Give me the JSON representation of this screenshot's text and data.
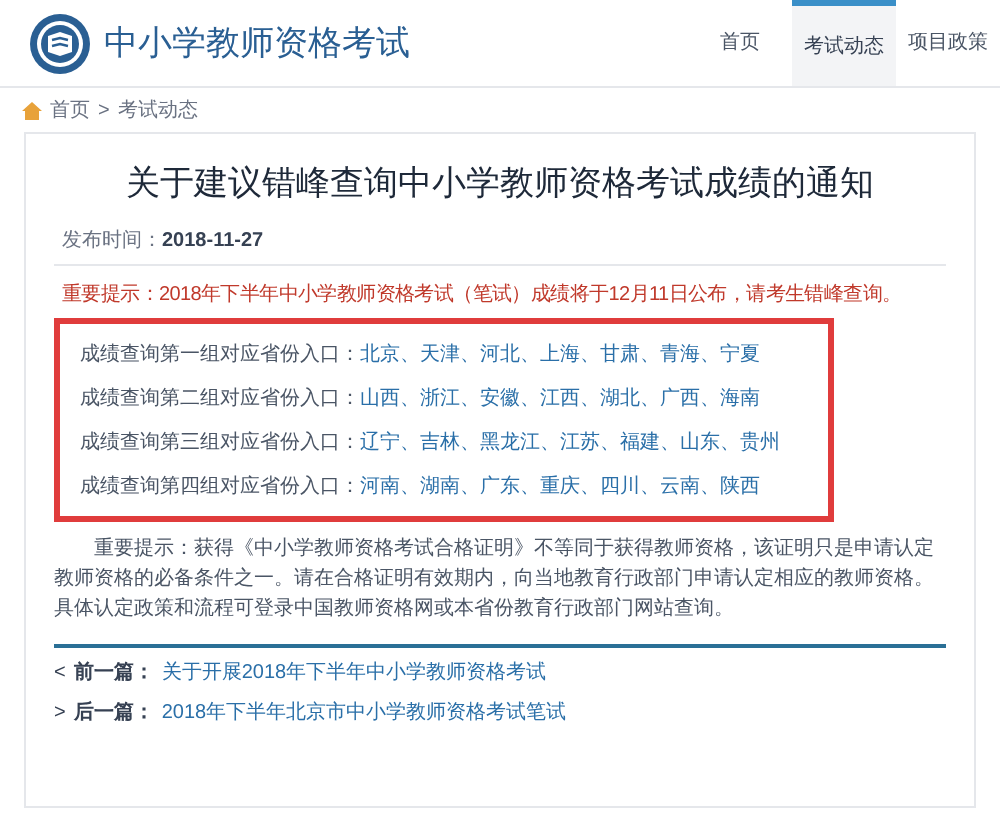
{
  "header": {
    "site_title": "中小学教师资格考试",
    "nav": [
      {
        "label": "首页",
        "selected": false
      },
      {
        "label": "考试动态",
        "selected": true
      },
      {
        "label": "项目政策",
        "selected": false
      }
    ]
  },
  "breadcrumb": [
    "首页",
    "考试动态"
  ],
  "breadcrumb_separator": ">",
  "article": {
    "title": "关于建议错峰查询中小学教师资格考试成绩的通知",
    "date_label": "发布时间：",
    "date": "2018-11-27",
    "notice": "重要提示：2018年下半年中小学教师资格考试（笔试）成绩将于12月11日公布，请考生错峰查询。",
    "groups": [
      {
        "label": "成绩查询第一组对应省份入口：",
        "provinces": "北京、天津、河北、上海、甘肃、青海、宁夏"
      },
      {
        "label": "成绩查询第二组对应省份入口：",
        "provinces": "山西、浙江、安徽、江西、湖北、广西、海南"
      },
      {
        "label": "成绩查询第三组对应省份入口：",
        "provinces": "辽宁、吉林、黑龙江、江苏、福建、山东、贵州"
      },
      {
        "label": "成绩查询第四组对应省份入口：",
        "provinces": "河南、湖南、广东、重庆、四川、云南、陕西"
      }
    ],
    "paragraph": "重要提示：获得《中小学教师资格考试合格证明》不等同于获得教师资格，该证明只是申请认定教师资格的必备条件之一。请在合格证明有效期内，向当地教育行政部门申请认定相应的教师资格。具体认定政策和流程可登录中国教师资格网或本省份教育行政部门网站查询。",
    "prev": {
      "marker": "<",
      "label": "前一篇：",
      "link": "关于开展2018年下半年中小学教师资格考试"
    },
    "next": {
      "marker": ">",
      "label": "后一篇：",
      "link": "2018年下半年北京市中小学教师资格考试笔试"
    }
  }
}
